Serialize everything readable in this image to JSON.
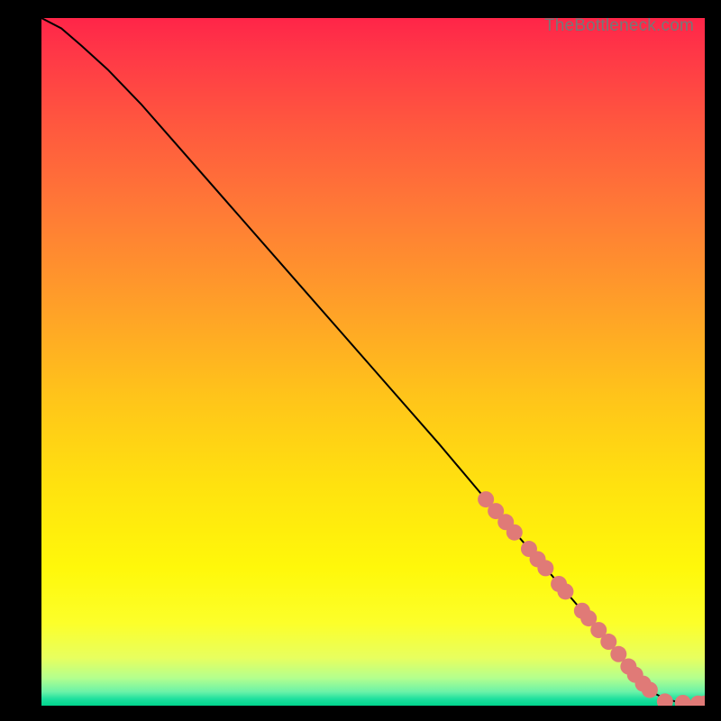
{
  "watermark": "TheBottleneck.com",
  "chart_data": {
    "type": "line",
    "title": "",
    "xlabel": "",
    "ylabel": "",
    "xlim": [
      0,
      100
    ],
    "ylim": [
      0,
      100
    ],
    "grid": false,
    "legend": false,
    "series": [
      {
        "name": "curve",
        "x": [
          0,
          3,
          6,
          10,
          15,
          20,
          30,
          40,
          50,
          60,
          67,
          72,
          76,
          80,
          84,
          87,
          89.5,
          92,
          94,
          96,
          98,
          100
        ],
        "y": [
          100,
          98.5,
          96,
          92.5,
          87.5,
          82,
          71,
          60,
          49,
          38,
          30,
          24.5,
          20,
          15.5,
          11,
          7.5,
          4.5,
          2,
          1,
          0.5,
          0.3,
          0.3
        ]
      }
    ],
    "highlight_points": {
      "name": "dots",
      "color": "#e07a77",
      "points": [
        {
          "x": 67,
          "y": 30
        },
        {
          "x": 68.5,
          "y": 28.3
        },
        {
          "x": 70,
          "y": 26.7
        },
        {
          "x": 71.3,
          "y": 25.2
        },
        {
          "x": 73.5,
          "y": 22.8
        },
        {
          "x": 74.8,
          "y": 21.3
        },
        {
          "x": 76,
          "y": 20
        },
        {
          "x": 78,
          "y": 17.7
        },
        {
          "x": 79,
          "y": 16.6
        },
        {
          "x": 81.5,
          "y": 13.8
        },
        {
          "x": 82.5,
          "y": 12.7
        },
        {
          "x": 84,
          "y": 11
        },
        {
          "x": 85.5,
          "y": 9.3
        },
        {
          "x": 87,
          "y": 7.5
        },
        {
          "x": 88.5,
          "y": 5.7
        },
        {
          "x": 89.5,
          "y": 4.5
        },
        {
          "x": 90.7,
          "y": 3.2
        },
        {
          "x": 91.7,
          "y": 2.3
        },
        {
          "x": 94,
          "y": 0.6
        },
        {
          "x": 96.7,
          "y": 0.4
        },
        {
          "x": 99,
          "y": 0.3
        },
        {
          "x": 100,
          "y": 0.3
        }
      ]
    }
  }
}
